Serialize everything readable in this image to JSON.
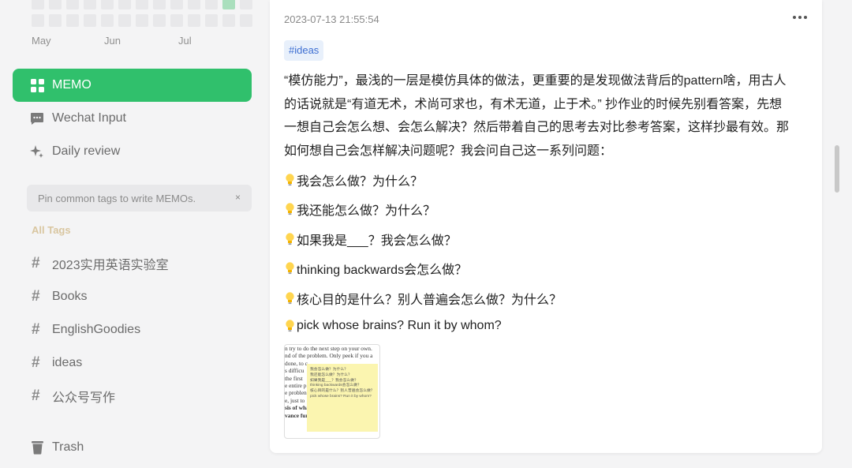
{
  "heatmap": {
    "weeks": [
      [
        0,
        0,
        0,
        0,
        0,
        0,
        0,
        0,
        0,
        0,
        0,
        1,
        0
      ],
      [
        0,
        0,
        0,
        0,
        0,
        0,
        0,
        0,
        0,
        0,
        0,
        0,
        0
      ]
    ],
    "months": [
      "May",
      "Jun",
      "Jul"
    ],
    "active_color": "#aadfbd",
    "empty_color": "#e8e8ea"
  },
  "nav": {
    "memo": "MEMO",
    "wechat": "Wechat Input",
    "daily": "Daily review",
    "trash": "Trash"
  },
  "pin_hint": {
    "text": "Pin common tags to write MEMOs.",
    "close": "×"
  },
  "tags": {
    "heading": "All Tags",
    "items": [
      "2023实用英语实验室",
      "Books",
      "EnglishGoodies",
      "ideas",
      "公众号写作"
    ]
  },
  "memo": {
    "timestamp": "2023-07-13 21:55:54",
    "tag": "#ideas",
    "paragraph_lines": [
      "“模仿能力”，最浅的一层是模仿具体的做法，更重要的是发现做法背后的pattern啥，用古人",
      "的话说就是“有道无术，术尚可求也，有术无道，止于术。” 抄作业的时候先别看答案，先想",
      "一想自己会怎么想、会怎么解决？然后带着自己的思考去对比参考答案，这样抄最有效。那",
      "如何想自己会怎样解决问题呢？我会问自己这一系列问题："
    ],
    "questions": [
      "我会怎么做？为什么？",
      "我还能怎么做？为什么？",
      "如果我是___？我会怎么做？",
      "thinking backwards会怎么做？",
      "核心目的是什么？别人普遍会怎么做？为什么？",
      "pick whose brains? Run it by whom?"
    ],
    "thumbnail": {
      "book_lines": [
        "n try to do the next step on your own.",
        "nd of the problem. Only peek if you a",
        "done, to c",
        "s difficu",
        "the first",
        "e entire p",
        "e problen",
        "",
        "e, just to",
        "",
        "sis of what",
        "vance furth"
      ],
      "note_lines": [
        "我会怎么做？为什么？",
        "我还能怎么做？为什么？",
        "如果我是___？我会怎么做？",
        "thinking backwards会怎么做？",
        "核心目的是什么？别人普遍会怎么做？",
        "pick whose brains? Run it by whom?"
      ]
    }
  },
  "colors": {
    "accent": "#30c06c",
    "tag_bg": "#e8f0fb",
    "tag_text": "#3e6fd2"
  }
}
